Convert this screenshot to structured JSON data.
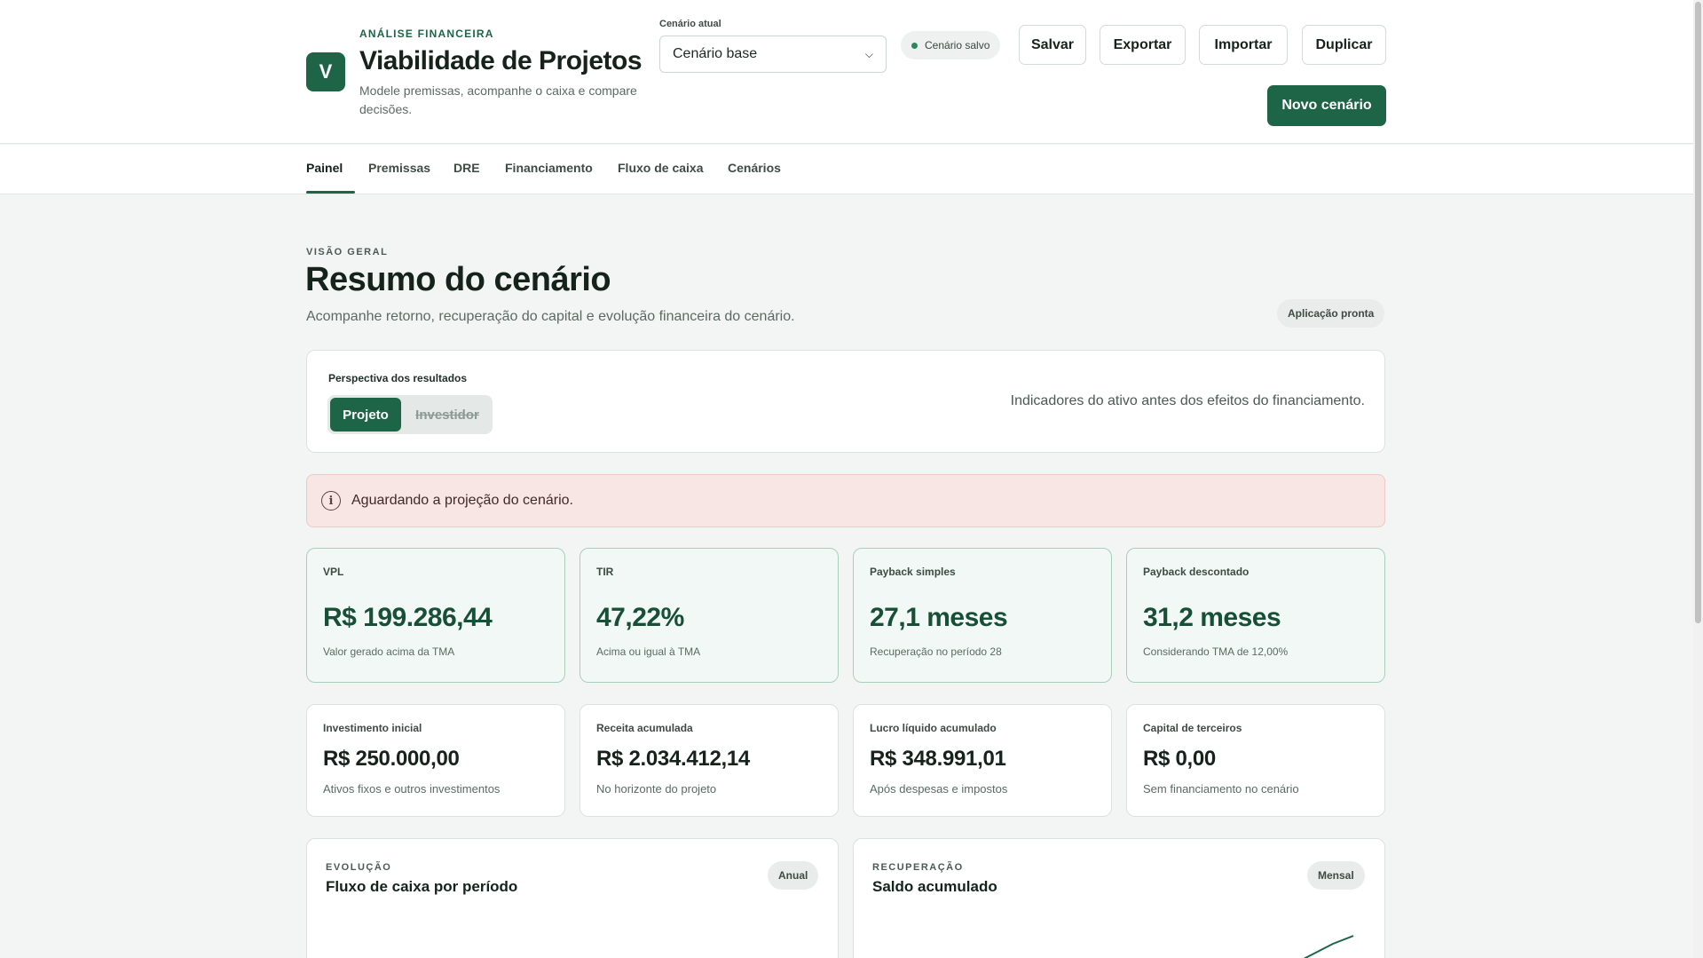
{
  "header": {
    "logo_letter": "V",
    "eyebrow": "ANÁLISE FINANCEIRA",
    "title": "Viabilidade de Projetos",
    "subtitle": "Modele premissas, acompanhe o caixa e compare decisões.",
    "scenario_label": "Cenário atual",
    "scenario_value": "Cenário base",
    "status": "Cenário salvo",
    "buttons": {
      "save": "Salvar",
      "export": "Exportar",
      "import": "Importar",
      "duplicate": "Duplicar",
      "new": "Novo cenário"
    }
  },
  "tabs": [
    {
      "label": "Painel",
      "active": true
    },
    {
      "label": "Premissas"
    },
    {
      "label": "DRE"
    },
    {
      "label": "Financiamento"
    },
    {
      "label": "Fluxo de caixa"
    },
    {
      "label": "Cenários"
    }
  ],
  "section": {
    "eyebrow": "VISÃO GERAL",
    "title": "Resumo do cenário",
    "subtitle": "Acompanhe retorno, recuperação do capital e evolução financeira do cenário.",
    "ready": "Aplicação pronta"
  },
  "perspective": {
    "label": "Perspectiva dos resultados",
    "options": [
      "Projeto",
      "Investidor"
    ],
    "selected": "Projeto",
    "note": "Indicadores do ativo antes dos efeitos do financiamento."
  },
  "alert": {
    "icon": "info-icon",
    "text": "Aguardando a projeção do cenário."
  },
  "kpis": [
    {
      "label": "VPL",
      "value": "R$ 199.286,44",
      "note": "Valor gerado acima da TMA"
    },
    {
      "label": "TIR",
      "value": "47,22%",
      "note": "Acima ou igual à TMA"
    },
    {
      "label": "Payback simples",
      "value": "27,1 meses",
      "note": "Recuperação no período 28"
    },
    {
      "label": "Payback descontado",
      "value": "31,2 meses",
      "note": "Considerando TMA de 12,00%"
    }
  ],
  "stats": [
    {
      "label": "Investimento inicial",
      "value": "R$ 250.000,00",
      "note": "Ativos fixos e outros investimentos"
    },
    {
      "label": "Receita acumulada",
      "value": "R$ 2.034.412,14",
      "note": "No horizonte do projeto"
    },
    {
      "label": "Lucro líquido acumulado",
      "value": "R$ 348.991,01",
      "note": "Após despesas e impostos"
    },
    {
      "label": "Capital de terceiros",
      "value": "R$ 0,00",
      "note": "Sem financiamento no cenário"
    }
  ],
  "panels": [
    {
      "eyebrow": "EVOLUÇÃO",
      "title": "Fluxo de caixa por período",
      "period": "Anual"
    },
    {
      "eyebrow": "RECUPERAÇÃO",
      "title": "Saldo acumulado",
      "period": "Mensal"
    }
  ],
  "colors": {
    "accent": "#1d6546",
    "kpi_bg": "#f2f8f5",
    "alert_bg": "#f8e6e4"
  }
}
